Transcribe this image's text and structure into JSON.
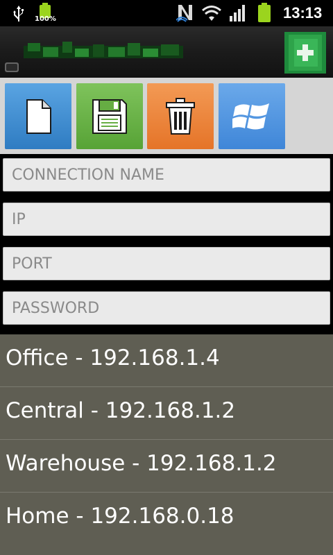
{
  "status_bar": {
    "battery_percent": "100%",
    "time": "13:13"
  },
  "title_bar": {
    "title": ""
  },
  "toolbar": {
    "new_icon": "new-document-icon",
    "save_icon": "floppy-disk-icon",
    "delete_icon": "trash-can-icon",
    "windows_icon": "windows-logo-icon"
  },
  "form": {
    "connection_name_placeholder": "CONNECTION NAME",
    "ip_placeholder": "IP",
    "port_placeholder": "PORT",
    "password_placeholder": "PASSWORD"
  },
  "connections": [
    {
      "label": "Office - 192.168.1.4"
    },
    {
      "label": "Central - 192.168.1.2"
    },
    {
      "label": "Warehouse - 192.168.1.2"
    },
    {
      "label": "Home - 192.168.0.18"
    }
  ],
  "colors": {
    "list_background": "#5f5e53",
    "toolbar_background": "#d5d5d5",
    "new_button": "#3f8ccc",
    "save_button": "#66ad43",
    "delete_button": "#ea7f35",
    "windows_button": "#4d91dd",
    "add_button": "#2ea34a"
  }
}
